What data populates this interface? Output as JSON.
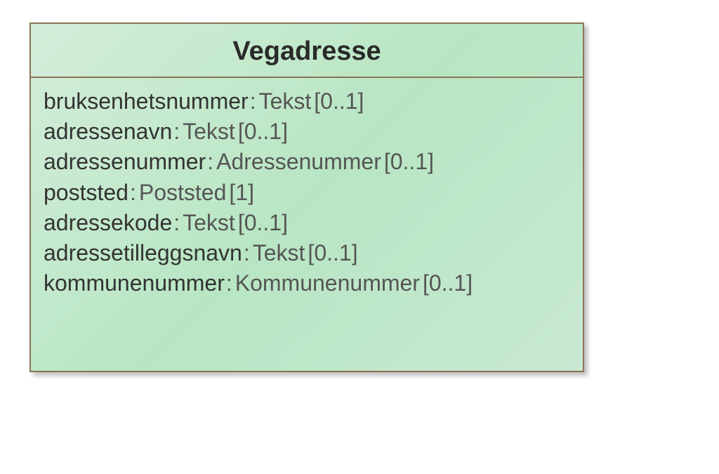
{
  "class": {
    "name": "Vegadresse",
    "attributes": [
      {
        "name": "bruksenhetsnummer",
        "type": "Tekst",
        "multiplicity": "[0..1]"
      },
      {
        "name": "adressenavn",
        "type": "Tekst",
        "multiplicity": "[0..1]"
      },
      {
        "name": "adressenummer",
        "type": "Adressenummer",
        "multiplicity": "[0..1]"
      },
      {
        "name": "poststed",
        "type": "Poststed",
        "multiplicity": "[1]"
      },
      {
        "name": "adressekode",
        "type": "Tekst",
        "multiplicity": "[0..1]"
      },
      {
        "name": "adressetilleggsnavn",
        "type": "Tekst",
        "multiplicity": "[0..1]"
      },
      {
        "name": "kommunenummer",
        "type": "Kommunenummer",
        "multiplicity": "[0..1]"
      }
    ]
  }
}
